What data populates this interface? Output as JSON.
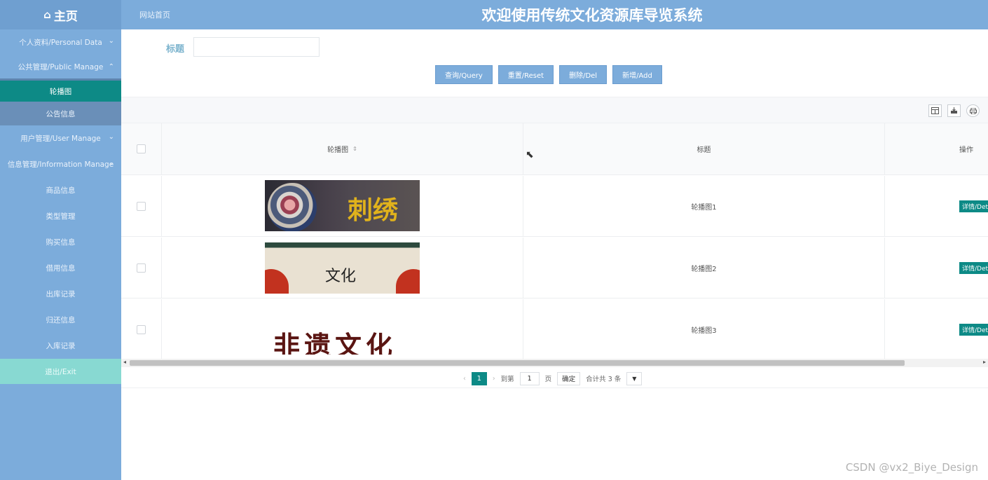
{
  "header": {
    "home_icon": "⌂",
    "home_label": "主页",
    "site_link": "网站首页",
    "title": "欢迎使用传统文化资源库导览系统"
  },
  "sidebar": {
    "items": [
      {
        "label": "个人资料/Personal Data",
        "chevron": "⌄"
      },
      {
        "label": "公共管理/Public Manage",
        "chevron": "⌃"
      },
      {
        "label": "轮播图"
      },
      {
        "label": "公告信息"
      },
      {
        "label": "用户管理/User Manage",
        "chevron": "⌄"
      },
      {
        "label": "信息管理/Information Manage",
        "chevron": "⌄"
      },
      {
        "label": "商品信息"
      },
      {
        "label": "类型管理"
      },
      {
        "label": "购买信息"
      },
      {
        "label": "借用信息"
      },
      {
        "label": "出库记录"
      },
      {
        "label": "归还信息"
      },
      {
        "label": "入库记录"
      },
      {
        "label": "退出/Exit"
      }
    ]
  },
  "search": {
    "label": "标题",
    "value": ""
  },
  "buttons": {
    "query": "查询/Query",
    "reset": "重置/Reset",
    "delete": "删除/Del",
    "add": "新增/Add"
  },
  "toolbar_icons": [
    "filter-columns-icon",
    "export-icon",
    "print-icon"
  ],
  "table": {
    "headers": {
      "image": "轮播图",
      "title": "标题",
      "action": "操作"
    },
    "sort_glyph": "⇕",
    "rows": [
      {
        "title": "轮播图1",
        "action": "详情/Detail",
        "image_text": "刺绣"
      },
      {
        "title": "轮播图2",
        "action": "详情/Detail",
        "image_text": "文化"
      },
      {
        "title": "轮播图3",
        "action": "详情/Detail",
        "image_text": "非遗文化"
      }
    ]
  },
  "pagination": {
    "current_page": "1",
    "goto_label": "到第",
    "goto_value": "1",
    "page_unit": "页",
    "confirm": "确定",
    "total": "合计共 3 条"
  },
  "watermark": "CSDN @vx2_Biye_Design"
}
